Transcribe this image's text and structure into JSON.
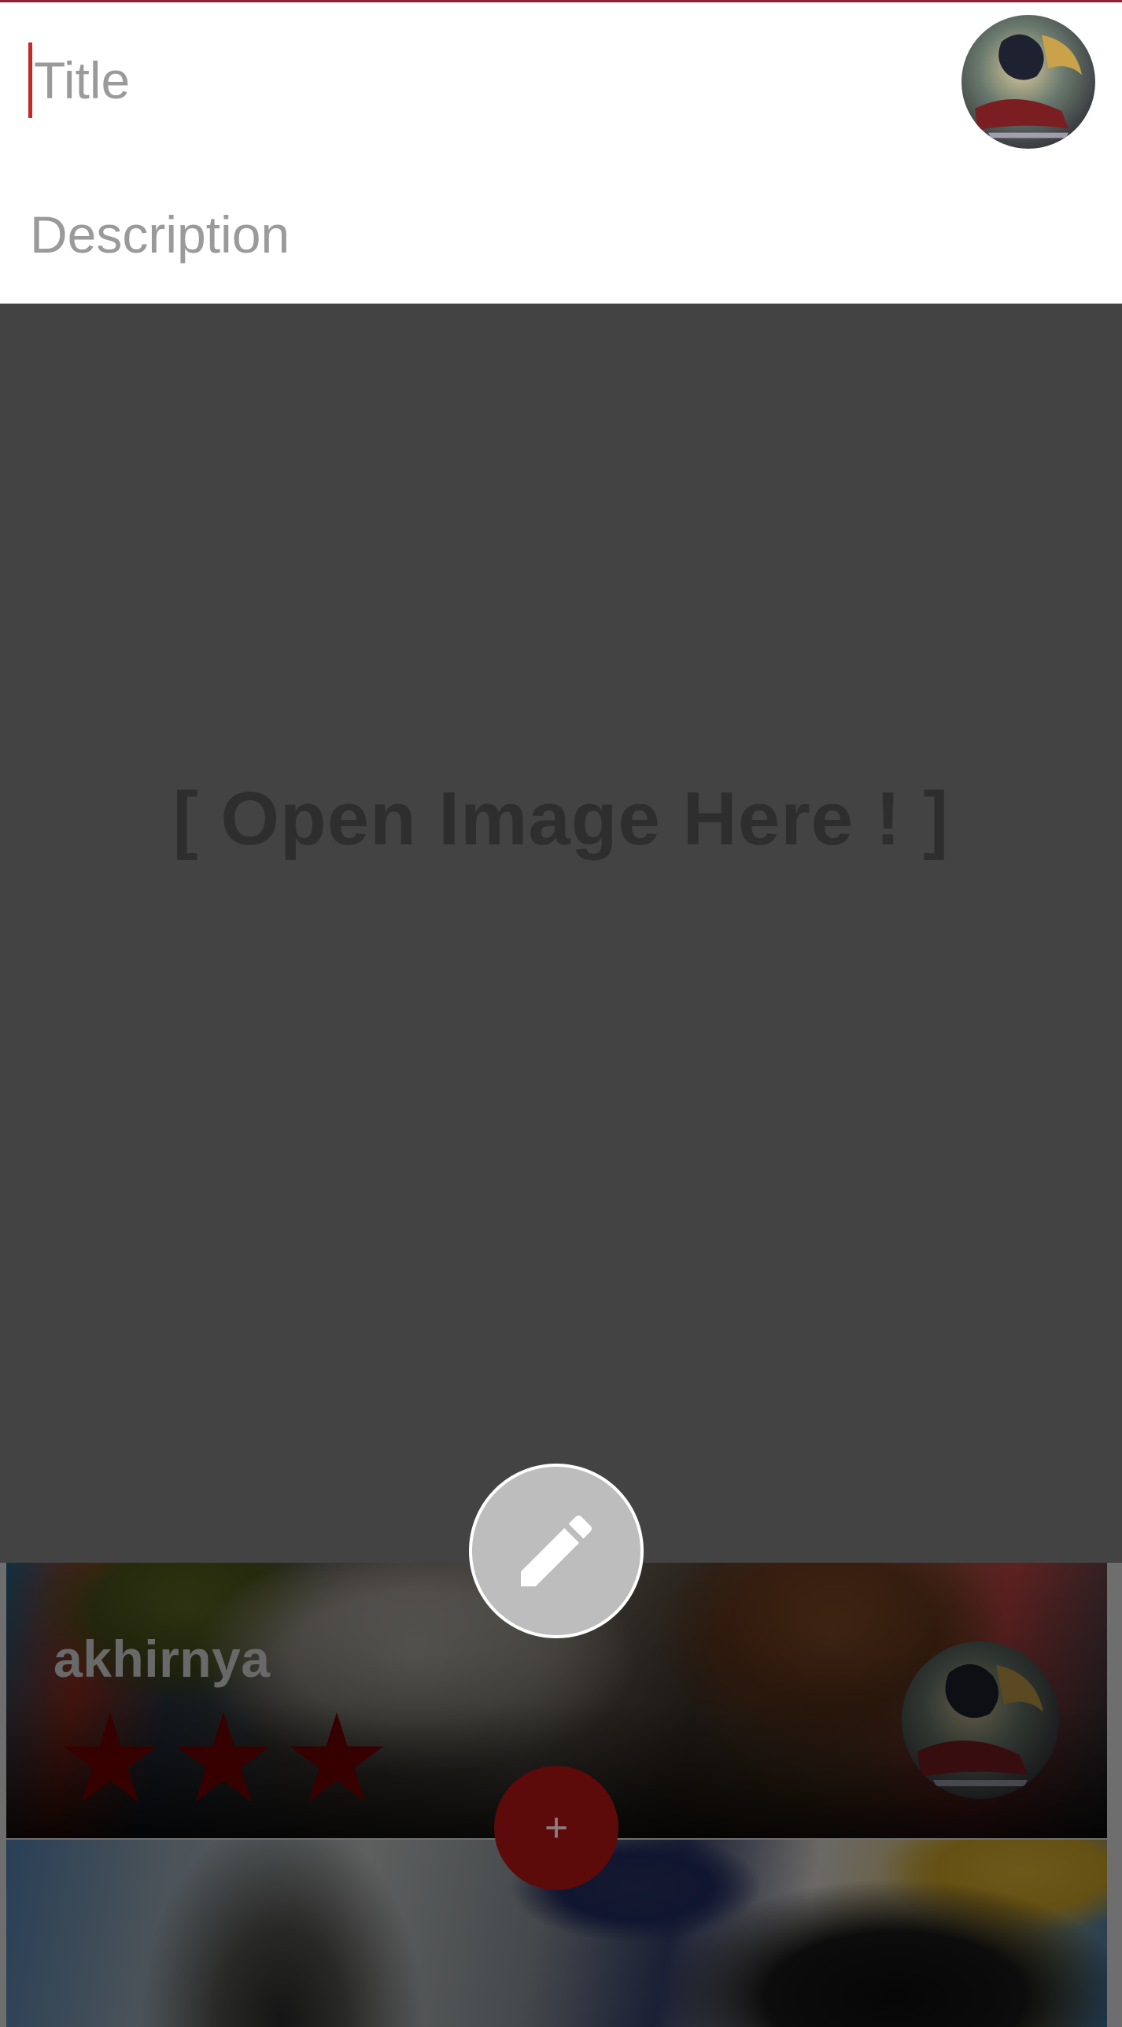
{
  "dialog": {
    "title_placeholder": "Title",
    "description_placeholder": "Description",
    "image_placeholder": "[ Open Image Here ! ]",
    "avatar_icon": "user-avatar-icon",
    "edit_button_icon": "pencil-icon"
  },
  "feed": {
    "cards": [
      {
        "username": "akhirnya",
        "rating": 3,
        "rating_max": 3,
        "avatar_icon": "user-avatar-icon"
      },
      {
        "username": "",
        "rating": null
      }
    ],
    "add_button_label": "+",
    "add_button_icon": "plus-icon"
  },
  "colors": {
    "accent": "#8f2335",
    "caret": "#c62828",
    "star": "#7a0000",
    "fab_add": "#5d0a0a",
    "fab_edit": "#bdbdbd",
    "image_area": "#434343"
  }
}
